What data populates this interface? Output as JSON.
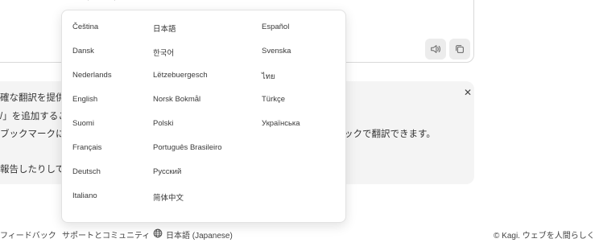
{
  "info": {
    "lines": [
      "確な翻訳を提供",
      "/」を追加するこ",
      "ブックマークに",
      "報告したりして"
    ],
    "right_text": "ックで翻訳できます。"
  },
  "footer": {
    "feedback": "フィードバック",
    "support": "サポートとコミュニティ",
    "language": "日本語 (Japanese)",
    "copyright": "© Kagi. ウェブを人間らしく。"
  },
  "languages": [
    "Čeština",
    "日本語",
    "Español",
    "Dansk",
    "한국어",
    "Svenska",
    "Nederlands",
    "Lëtzebuergesch",
    "ไทย",
    "English",
    "Norsk Bokmål",
    "Türkçe",
    "Suomi",
    "Polski",
    "Українська",
    "Français",
    "Português Brasileiro",
    "Deutsch",
    "Русский",
    "Italiano",
    "简体中文"
  ],
  "icons": {
    "speaker": "speaker-icon",
    "copy": "copy-icon",
    "close": "close-icon",
    "globe": "globe-icon"
  }
}
